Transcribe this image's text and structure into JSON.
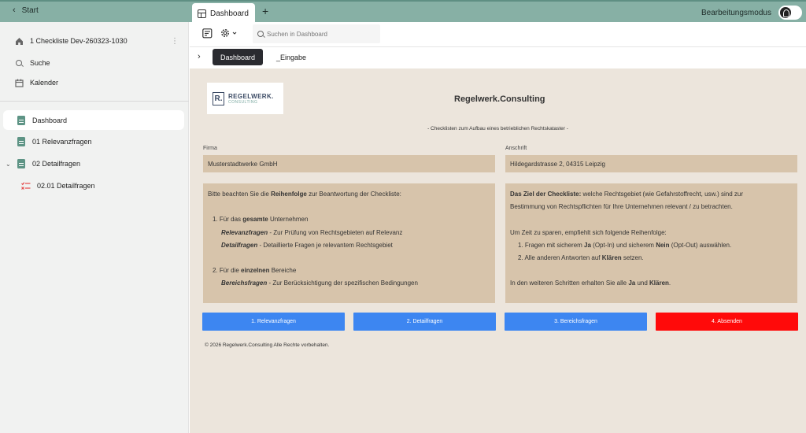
{
  "topbar": {
    "start_label": "Start",
    "tab_label": "Dashboard",
    "add_tab_glyph": "+",
    "edit_mode_label": "Bearbeitungsmodus"
  },
  "sidebar": {
    "project_title": "1 Checkliste Dev-260323-1030",
    "search_label": "Suche",
    "calendar_label": "Kalender",
    "items": [
      {
        "label": "Dashboard",
        "icon": "document-icon",
        "active": true
      },
      {
        "label": "01 Relevanzfragen",
        "icon": "document-icon"
      },
      {
        "label": "02 Detailfragen",
        "icon": "document-icon",
        "expanded": true
      },
      {
        "label": "02.01 Detailfragen",
        "icon": "checklist-icon"
      }
    ]
  },
  "toolbar": {
    "search_placeholder": "Suchen in Dashboard"
  },
  "subtabs": {
    "active": "Dashboard",
    "inactive": "_Eingabe"
  },
  "main": {
    "logo_main": "REGELWERK.",
    "logo_sub": "CONSULTING",
    "logo_letter": "R.",
    "company_title": "Regelwerk.Consulting",
    "subtitle": "- Checklisten zum Aufbau eines betrieblichen Rechtskataster -",
    "firma_label": "Firma",
    "firma_value": "Musterstadtwerke GmbH",
    "anschrift_label": "Anschrift",
    "anschrift_value": "Hildegardstrasse 2, 04315 Leipzig",
    "left_box": {
      "intro_pre": "Bitte beachten Sie die ",
      "intro_bold": "Reihenfolge",
      "intro_post": " zur Beantwortung der Checkliste:",
      "point1_pre": "1. Für das ",
      "point1_bold": "gesamte",
      "point1_post": " Unternehmen",
      "relevanz_term": "Relevanzfragen",
      "relevanz_desc": " - Zur Prüfung von Rechtsgebieten auf Relevanz",
      "detail_term": "Detailfragen",
      "detail_desc": " - Detaillierte Fragen je relevantem Rechtsgebiet",
      "point2_pre": "2. Für die ",
      "point2_bold": "einzelnen",
      "point2_post": " Bereiche",
      "bereichs_term": "Bereichsfragen",
      "bereichs_desc": " - Zur Berücksichtigung der spezifischen Bedingungen"
    },
    "right_box": {
      "goal_bold": "Das Ziel der Checkliste:",
      "goal_line1": "  welche Rechtsgebiet (wie Gefahrstoffrecht, usw.) sind zur",
      "goal_line2": "Bestimmung von Rechtspflichten für Ihre Unternehmen relevant / zu betrachten.",
      "time_line": "Um Zeit zu sparen, empfiehlt sich folgende Reihenfolge:",
      "step1_pre": "1. Fragen mit sicherem ",
      "step1_ja": "Ja",
      "step1_mid": " (Opt-In) und sicherem ",
      "step1_nein": "Nein",
      "step1_post": " (Opt-Out) auswählen.",
      "step2_pre": "2. Alle anderen Antworten auf ",
      "step2_bold": "Klären",
      "step2_post": " setzen.",
      "final_pre": "In den weiteren Schritten erhalten Sie alle ",
      "final_ja": "Ja",
      "final_mid": " und ",
      "final_klaeren": "Klären",
      "final_post": "."
    },
    "buttons": [
      {
        "label": "1. Relevanzfragen",
        "color": "#3d86f1"
      },
      {
        "label": "2. Detailfragen",
        "color": "#3d86f1"
      },
      {
        "label": "3. Bereichsfragen",
        "color": "#3d86f1"
      },
      {
        "label": "4. Absenden",
        "color": "#ff0a0a"
      }
    ],
    "footer": "© 2026 Regelwerk.Consulting  Alle Rechte vorbehalten."
  },
  "colors": {
    "topbar": "#87b0a5",
    "sidebar_bg": "#f1f2f1",
    "main_bg": "#ece5dc",
    "field_bg": "#d7c4ab",
    "accent_doc": "#5e9485"
  }
}
